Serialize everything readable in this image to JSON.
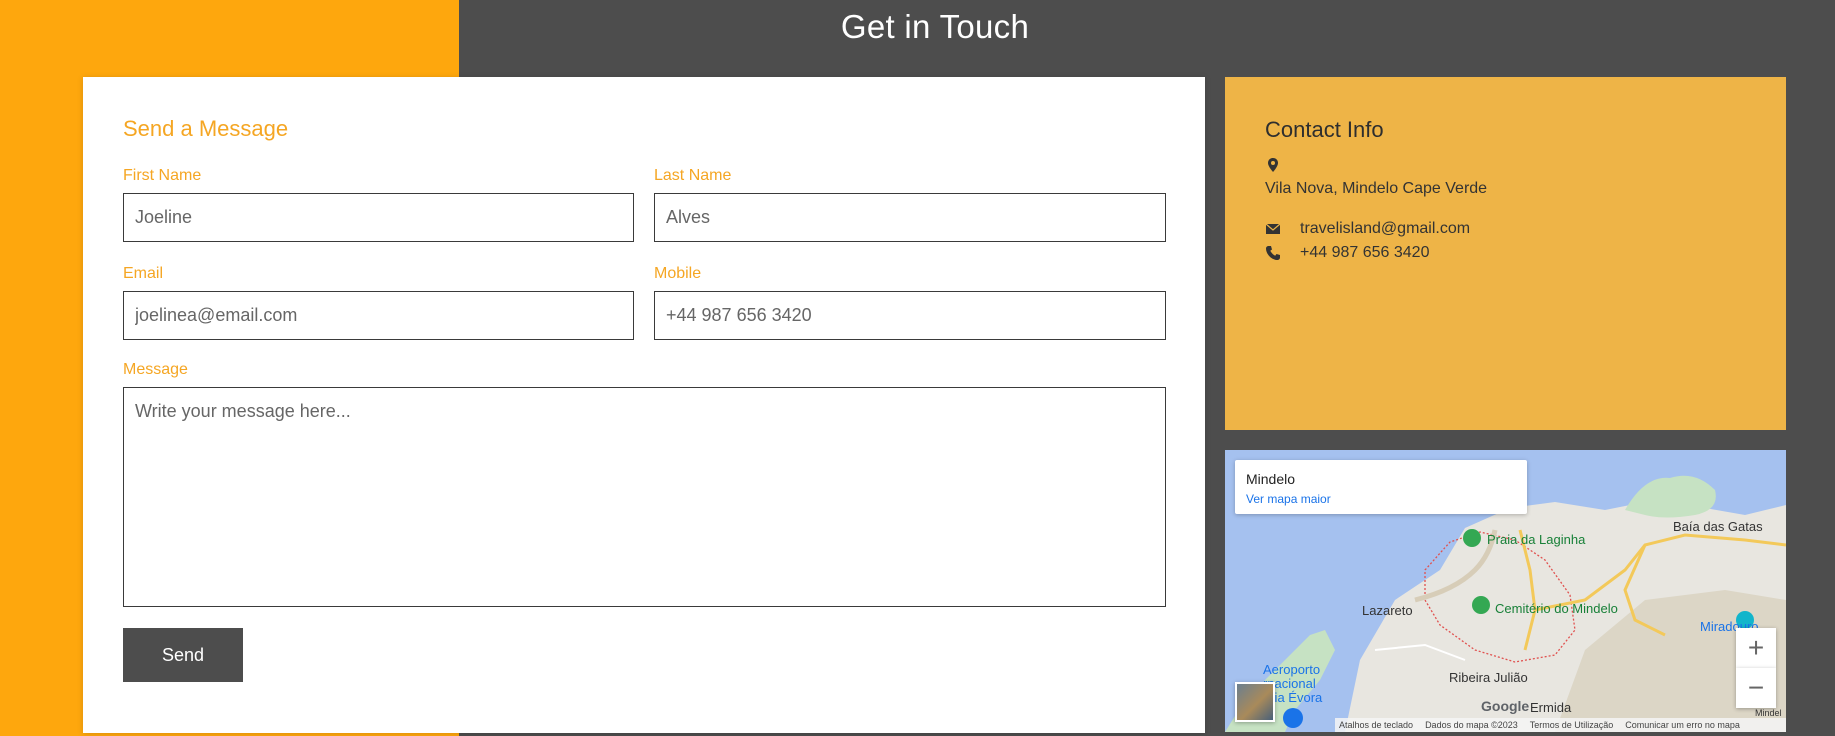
{
  "header": {
    "title": "Get in Touch"
  },
  "form": {
    "title": "Send a Message",
    "first_name": {
      "label": "First Name",
      "placeholder": "Joeline"
    },
    "last_name": {
      "label": "Last Name",
      "placeholder": "Alves"
    },
    "email": {
      "label": "Email",
      "placeholder": "joelinea@email.com"
    },
    "mobile": {
      "label": "Mobile",
      "placeholder": "+44 987 656 3420"
    },
    "message": {
      "label": "Message",
      "placeholder": "Write your message here..."
    },
    "send_label": "Send"
  },
  "contact": {
    "title": "Contact Info",
    "address": "Vila Nova, Mindelo Cape Verde",
    "email": "travelisland@gmail.com",
    "phone": "+44 987 656 3420",
    "icons": [
      "map-marker-icon",
      "envelope-icon",
      "phone-icon"
    ]
  },
  "map": {
    "place_title": "Mindelo",
    "larger_map_link": "Ver mapa maior",
    "labels": [
      "Praia da Laginha",
      "Baía das Gatas",
      "Lazareto",
      "Cemitério do Mindelo",
      "Miradouro",
      "Aeroporto",
      "rnacional",
      "ária Évora",
      "Ribeira Julião",
      "Ermida",
      "Mindel"
    ],
    "zoom_in": "+",
    "zoom_out": "−",
    "logo": "Google",
    "footer": {
      "shortcuts": "Atalhos de teclado",
      "map_data": "Dados do mapa ©2023",
      "terms": "Termos de Utilização",
      "report": "Comunicar um erro no mapa"
    }
  },
  "colors": {
    "accent": "#f5a623",
    "orange_bg": "#fea70d",
    "dark_bg": "#4d4d4d",
    "info_bg": "#eeb447"
  }
}
